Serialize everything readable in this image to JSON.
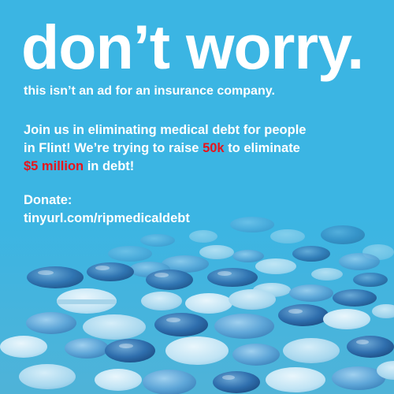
{
  "poster": {
    "headline": "don’t worry.",
    "subline": "this isn’t an ad for an insurance company.",
    "body": {
      "line1": "Join us in eliminating medical debt for people",
      "line2": "in Flint! We’re trying to raise ",
      "line2_highlight": "50k",
      "line2_end": " to eliminate",
      "line3_highlight": "$5 million",
      "line3_end": " in debt!"
    },
    "donate_label": "Donate:",
    "donate_url": "tinyurl.com/ripmedicaldebt",
    "background_image": "pills-photo",
    "colors": {
      "background": "#3bb5e3",
      "text": "#ffffff",
      "highlight": "#e8141b"
    }
  }
}
